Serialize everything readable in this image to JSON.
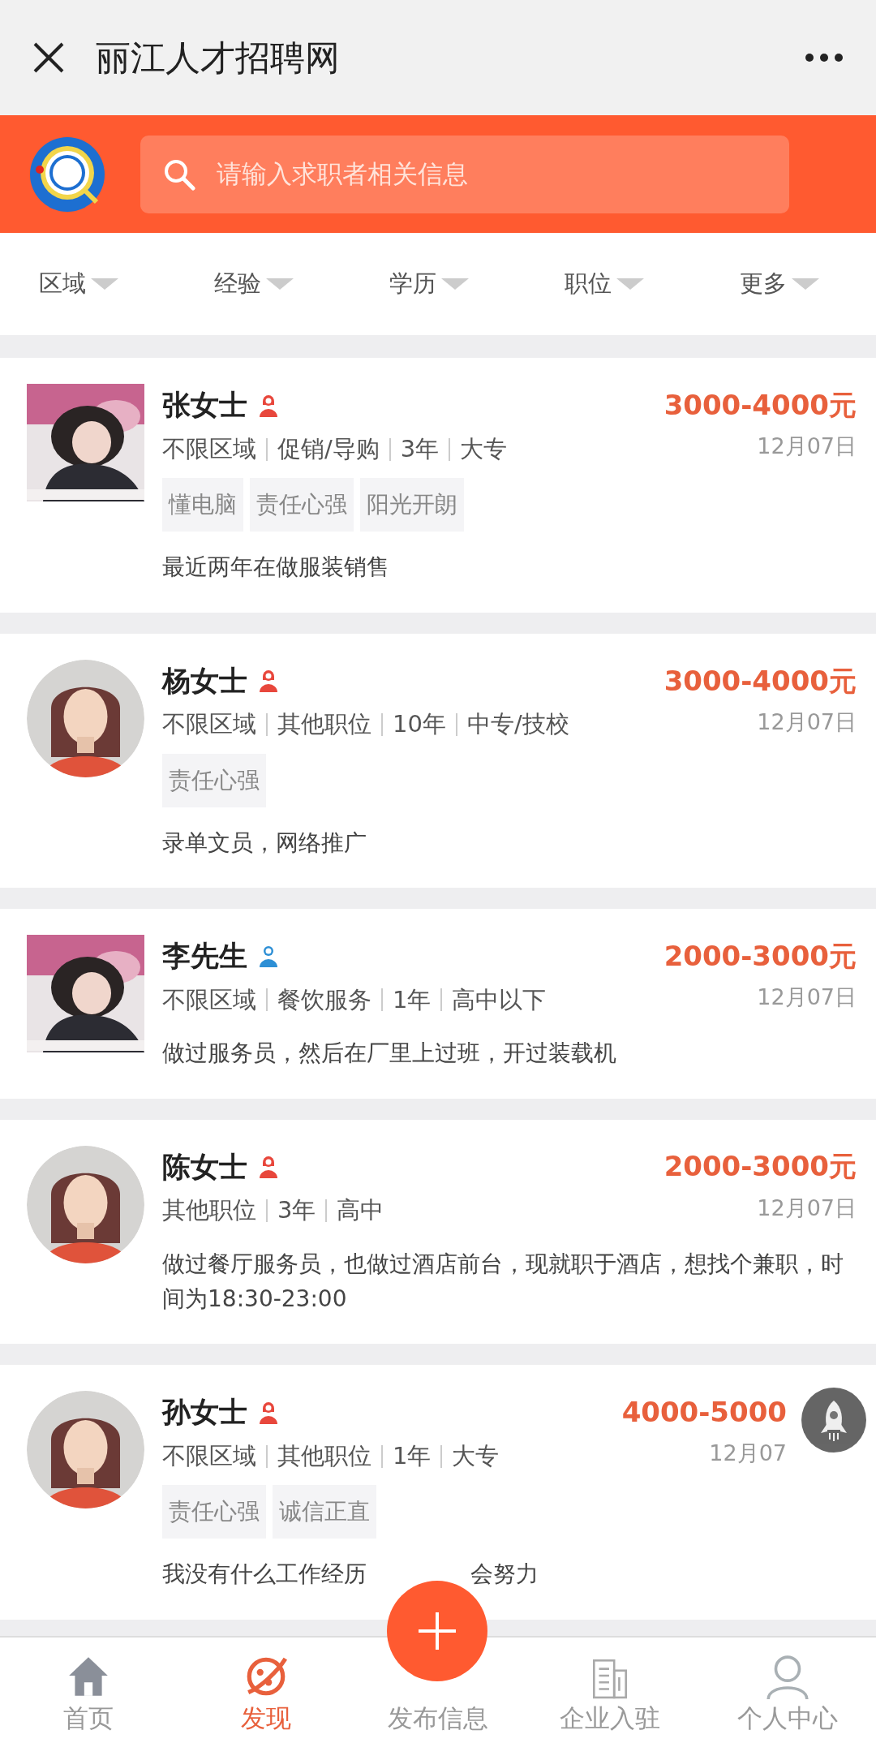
{
  "header": {
    "title": "丽江人才招聘网"
  },
  "search": {
    "placeholder": "请输入求职者相关信息"
  },
  "filters": [
    {
      "label": "区域"
    },
    {
      "label": "经验"
    },
    {
      "label": "学历"
    },
    {
      "label": "职位"
    },
    {
      "label": "更多"
    }
  ],
  "candidates": [
    {
      "name": "张女士",
      "kind": "female",
      "avatar": {
        "kind": "picture"
      },
      "salary": "3000-4000元",
      "info": [
        "不限区域",
        "促销/导购",
        "3年",
        "大专"
      ],
      "date": "12月07日",
      "tags": [
        "懂电脑",
        "责任心强",
        "阳光开朗"
      ],
      "description": [
        "最近两年在做服装销售"
      ]
    },
    {
      "name": "杨女士",
      "kind": "female",
      "avatar": {
        "kind": "default"
      },
      "salary": "3000-4000元",
      "info": [
        "不限区域",
        "其他职位",
        "10年",
        "中专/技校"
      ],
      "date": "12月07日",
      "tags": [
        "责任心强"
      ],
      "description": [
        "录单文员，网络推广"
      ]
    },
    {
      "name": "李先生",
      "kind": "male",
      "avatar": {
        "kind": "picture"
      },
      "salary": "2000-3000元",
      "info": [
        "不限区域",
        "餐饮服务",
        "1年",
        "高中以下"
      ],
      "date": "12月07日",
      "description": [
        "做过服务员，然后在厂里上过班，开过装载机"
      ]
    },
    {
      "name": "陈女士",
      "kind": "female",
      "avatar": {
        "kind": "default"
      },
      "salary": "2000-3000元",
      "info": [
        "其他职位",
        "3年",
        "高中"
      ],
      "date": "12月07日",
      "description": [
        "做过餐厅服务员，也做过酒店前台，现就职于酒店，想找个兼职，时间为18:30-23:00"
      ]
    },
    {
      "name": "孙女士",
      "kind": "female",
      "avatar": {
        "kind": "default"
      },
      "salary": "4000-5000",
      "info": [
        "不限区域",
        "其他职位",
        "1年",
        "大专"
      ],
      "date": "12月07",
      "tags": [
        "责任心强",
        "诚信正直"
      ],
      "description": [
        "我没有什么工作经历",
        "会努力"
      ]
    }
  ],
  "nav": [
    {
      "label": "首页",
      "selected": false
    },
    {
      "label": "发现",
      "selected": true
    },
    {
      "label": "发布信息",
      "selected": false
    },
    {
      "label": "企业入驻",
      "selected": false
    },
    {
      "label": "个人中心",
      "selected": false
    }
  ]
}
